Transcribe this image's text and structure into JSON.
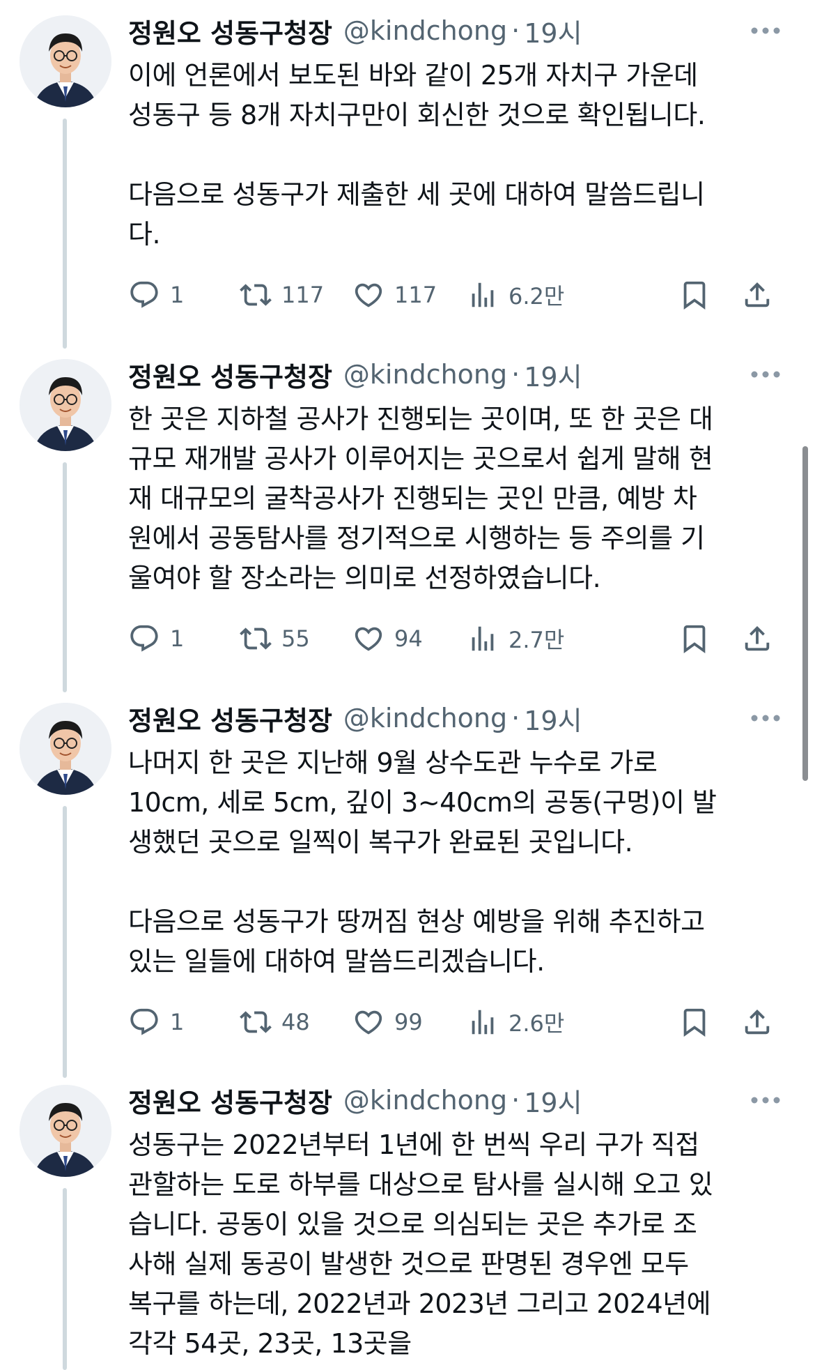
{
  "colors": {
    "text_primary": "#0f1419",
    "text_secondary": "#536471",
    "thread_line": "#cfd9de"
  },
  "tweets": [
    {
      "author": {
        "name": "정원오 성동구청장",
        "handle": "@kindchong"
      },
      "separator": "·",
      "time": "19시",
      "text": "이에 언론에서 보도된 바와 같이 25개 자치구 가운데\n성동구 등 8개 자치구만이 회신한 것으로 확인됩니다.\n\n다음으로 성동구가 제출한 세 곳에 대하여 말씀드립니\n다.",
      "stats": {
        "replies": "1",
        "reposts": "117",
        "likes": "117",
        "views": "6.2만"
      },
      "icons": [
        "reply-icon",
        "repost-icon",
        "like-icon",
        "views-icon",
        "bookmark-icon",
        "share-icon"
      ]
    },
    {
      "author": {
        "name": "정원오 성동구청장",
        "handle": "@kindchong"
      },
      "separator": "·",
      "time": "19시",
      "text": "한 곳은 지하철 공사가 진행되는 곳이며, 또 한 곳은 대\n규모 재개발 공사가 이루어지는 곳으로서 쉽게 말해 현\n재 대규모의 굴착공사가 진행되는 곳인 만큼, 예방 차\n원에서 공동탐사를 정기적으로 시행하는 등 주의를 기\n울여야 할 장소라는 의미로 선정하였습니다.",
      "stats": {
        "replies": "1",
        "reposts": "55",
        "likes": "94",
        "views": "2.7만"
      }
    },
    {
      "author": {
        "name": "정원오 성동구청장",
        "handle": "@kindchong"
      },
      "separator": "·",
      "time": "19시",
      "text": "나머지 한 곳은 지난해 9월 상수도관 누수로 가로\n10cm, 세로 5cm, 깊이 3~40cm의 공동(구멍)이 발\n생했던 곳으로 일찍이 복구가 완료된 곳입니다.\n\n다음으로 성동구가 땅꺼짐 현상 예방을 위해 추진하고\n있는 일들에 대하여 말씀드리겠습니다.",
      "stats": {
        "replies": "1",
        "reposts": "48",
        "likes": "99",
        "views": "2.6만"
      }
    },
    {
      "author": {
        "name": "정원오 성동구청장",
        "handle": "@kindchong"
      },
      "separator": "·",
      "time": "19시",
      "text": "성동구는 2022년부터 1년에 한 번씩 우리 구가 직접\n관할하는 도로 하부를 대상으로 탐사를 실시해 오고 있\n습니다. 공동이 있을 것으로 의심되는 곳은 추가로 조\n사해 실제 동공이 발생한 것으로 판명된 경우엔 모두\n복구를 하는데, 2022년과 2023년 그리고 2024년에\n각각 54곳, 23곳, 13곳을"
    }
  ]
}
